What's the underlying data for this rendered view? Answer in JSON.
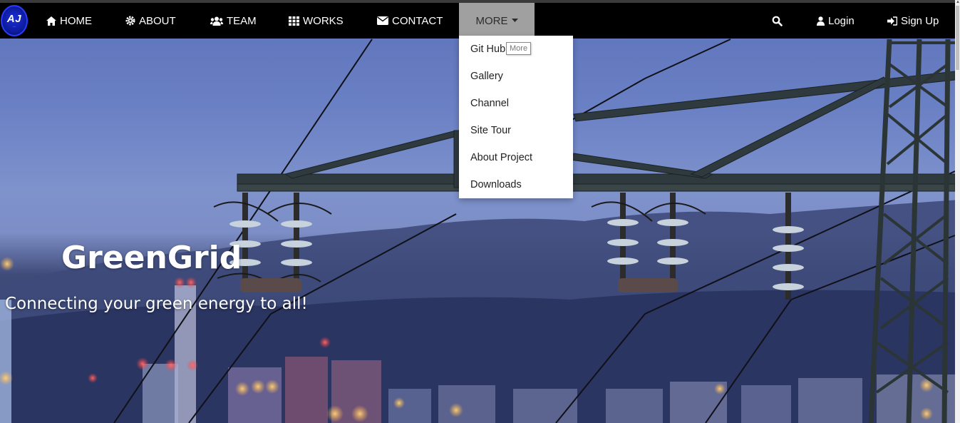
{
  "nav": {
    "logo_text": "AJ",
    "items": [
      {
        "label": "HOME",
        "icon": "home-icon"
      },
      {
        "label": "ABOUT",
        "icon": "gear-icon"
      },
      {
        "label": "TEAM",
        "icon": "users-icon"
      },
      {
        "label": "WORKS",
        "icon": "grid-icon"
      },
      {
        "label": "CONTACT",
        "icon": "envelope-icon"
      }
    ],
    "more_label": "MORE",
    "login_label": "Login",
    "signup_label": "Sign Up"
  },
  "dropdown": {
    "items": [
      "Git Hub",
      "Gallery",
      "Channel",
      "Site Tour",
      "About Project",
      "Downloads"
    ],
    "tooltip": "More"
  },
  "hero": {
    "title": "GreenGrid",
    "tagline": "Connecting your green energy to all!"
  },
  "colors": {
    "navbar_bg": "#000000",
    "more_active_bg": "#a0a0a0",
    "text_light": "#ffffff"
  }
}
